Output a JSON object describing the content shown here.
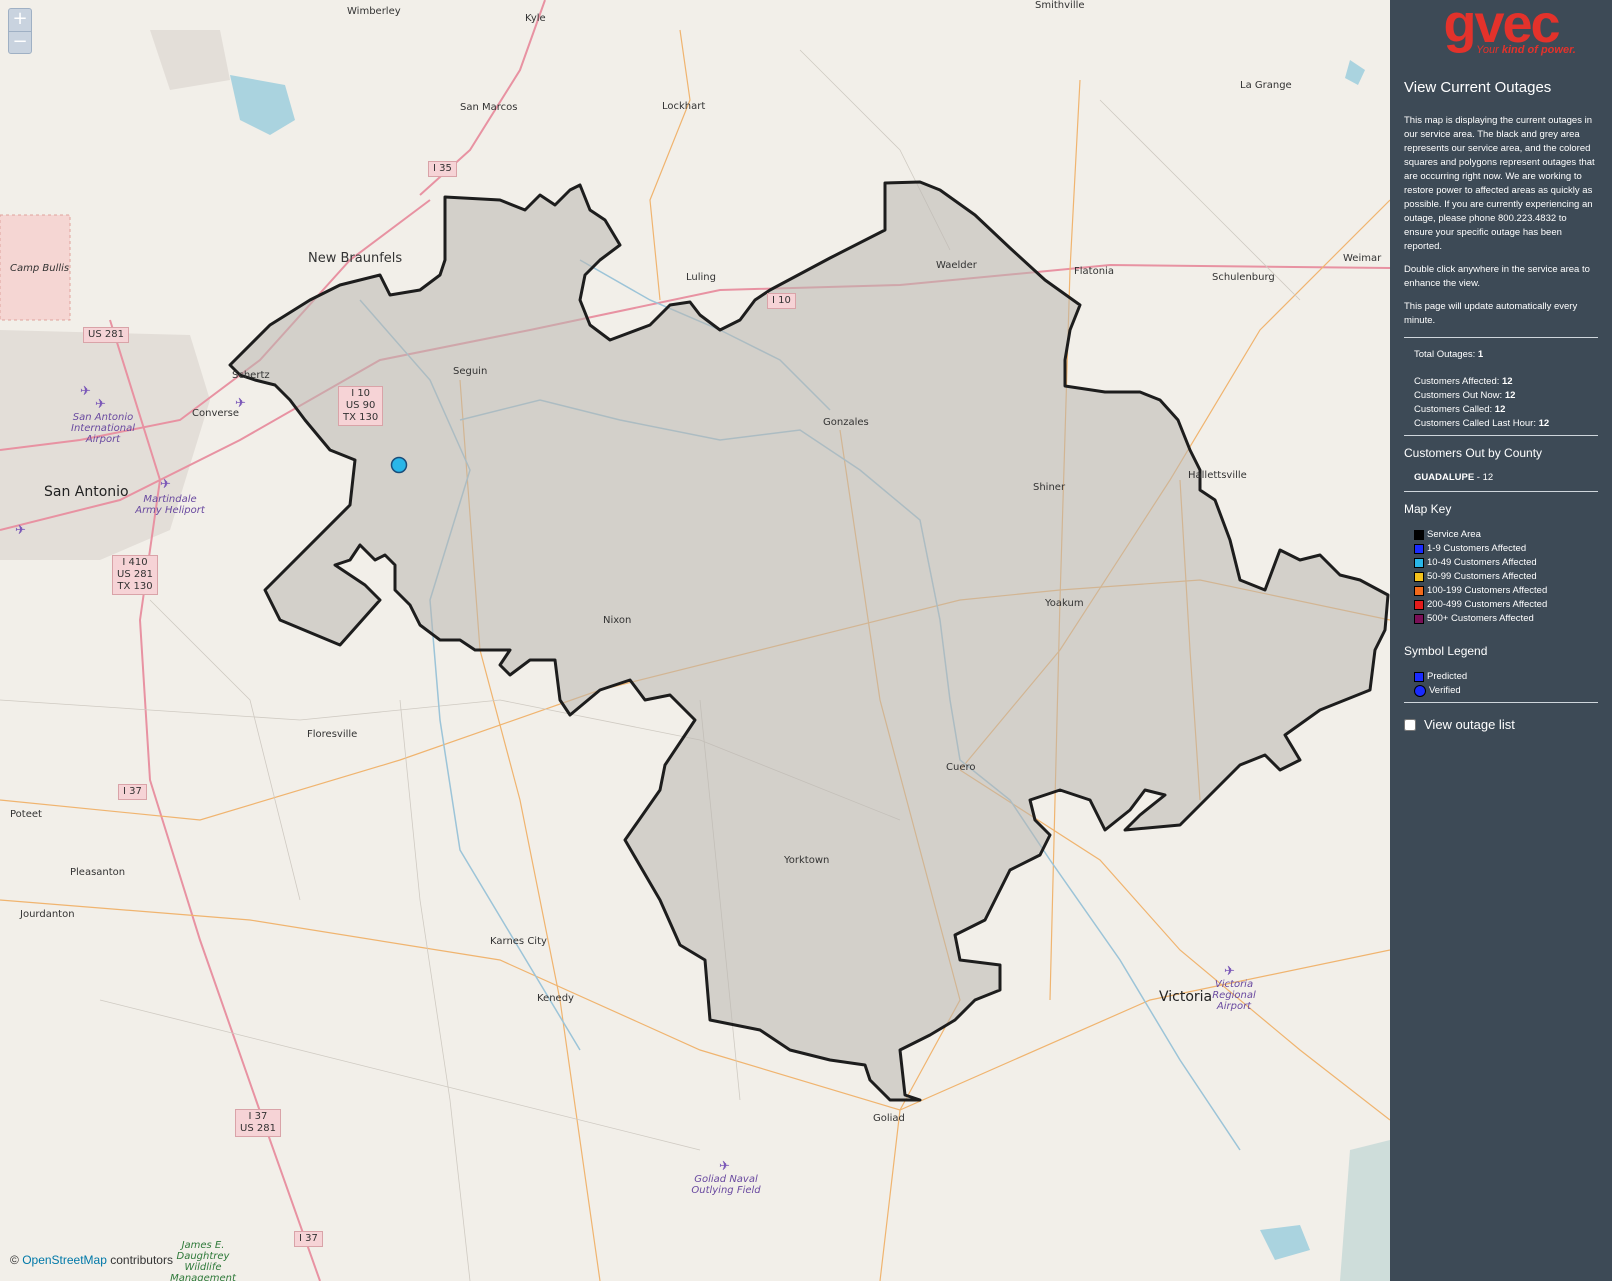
{
  "map": {
    "zoom_in": "+",
    "zoom_out": "−",
    "attribution_prefix": "©",
    "attribution_link": "OpenStreetMap",
    "attribution_suffix": "contributors",
    "places": {
      "wimberley": "Wimberley",
      "kyle": "Kyle",
      "smithville": "Smithville",
      "san_marcos": "San Marcos",
      "lockhart": "Lockhart",
      "la_grange": "La Grange",
      "new_braunfels": "New Braunfels",
      "luling": "Luling",
      "waelder": "Waelder",
      "flatonia": "Flatonia",
      "schulenburg": "Schulenburg",
      "weimar": "Weimar",
      "camp_bullis": "Camp Bullis",
      "schertz": "Schertz",
      "converse": "Converse",
      "seguin": "Seguin",
      "gonzales": "Gonzales",
      "san_antonio": "San Antonio",
      "sa_airport": "San Antonio International Airport",
      "martindale": "Martindale Army Heliport",
      "shiner": "Shiner",
      "hallettsville": "Hallettsville",
      "yoakum": "Yoakum",
      "nixon": "Nixon",
      "floresville": "Floresville",
      "cuero": "Cuero",
      "poteet": "Poteet",
      "pleasanton": "Pleasanton",
      "yorktown": "Yorktown",
      "jourdanton": "Jourdanton",
      "karnes_city": "Karnes City",
      "kenedy": "Kenedy",
      "victoria": "Victoria",
      "victoria_airport": "Victoria Regional Airport",
      "goliad": "Goliad",
      "goliad_field": "Goliad Naval Outlying Field",
      "james": "James E. Daughtrey Wildlife Management"
    },
    "shields": {
      "i35": "I 35",
      "i10_east": "I 10",
      "us281": "US 281",
      "i10_stack": "I 10\nUS 90\nTX 130",
      "i410_stack": "I 410\nUS 281\nTX 130",
      "i37_a": "I 37",
      "i37_b": "I 37\nUS 281",
      "i37_c": "I 37"
    },
    "outage_color": "#29b6e8"
  },
  "sidebar": {
    "logo_word": "gvec",
    "logo_tag_prefix": "Your ",
    "logo_tag_kind": "kind of power.",
    "title": "View Current Outages",
    "para1": "This map is displaying the current outages in our service area. The black and grey area represents our service area, and the colored squares and polygons represent outages that are occurring right now. We are working to restore power to affected areas as quickly as possible. If you are currently experiencing an outage, please phone 800.223.4832 to ensure your specific outage has been reported.",
    "para2": "Double click anywhere in the service area to enhance the view.",
    "para3": "This page will update automatically every minute.",
    "stats": {
      "total_label": "Total Outages:",
      "total_value": "1",
      "affected_label": "Customers Affected:",
      "affected_value": "12",
      "out_now_label": "Customers Out Now:",
      "out_now_value": "12",
      "called_label": "Customers Called:",
      "called_value": "12",
      "called_hour_label": "Customers Called Last Hour:",
      "called_hour_value": "12"
    },
    "county_title": "Customers Out by County",
    "county_name": "GUADALUPE",
    "county_value": " - 12",
    "map_key_title": "Map Key",
    "map_key": [
      {
        "label": "Service Area",
        "color": "#000000"
      },
      {
        "label": "1-9 Customers Affected",
        "color": "#1a2bff"
      },
      {
        "label": "10-49 Customers Affected",
        "color": "#29b6e8"
      },
      {
        "label": "50-99 Customers Affected",
        "color": "#f3c11b"
      },
      {
        "label": "100-199 Customers Affected",
        "color": "#f26a1b"
      },
      {
        "label": "200-499 Customers Affected",
        "color": "#e31b1b"
      },
      {
        "label": "500+ Customers Affected",
        "color": "#7a0f57"
      }
    ],
    "symbol_title": "Symbol Legend",
    "symbols": [
      {
        "label": "Predicted",
        "shape": "square",
        "color": "#1a2bff"
      },
      {
        "label": "Verified",
        "shape": "circle",
        "color": "#1a2bff"
      }
    ],
    "view_list": "View outage list"
  }
}
